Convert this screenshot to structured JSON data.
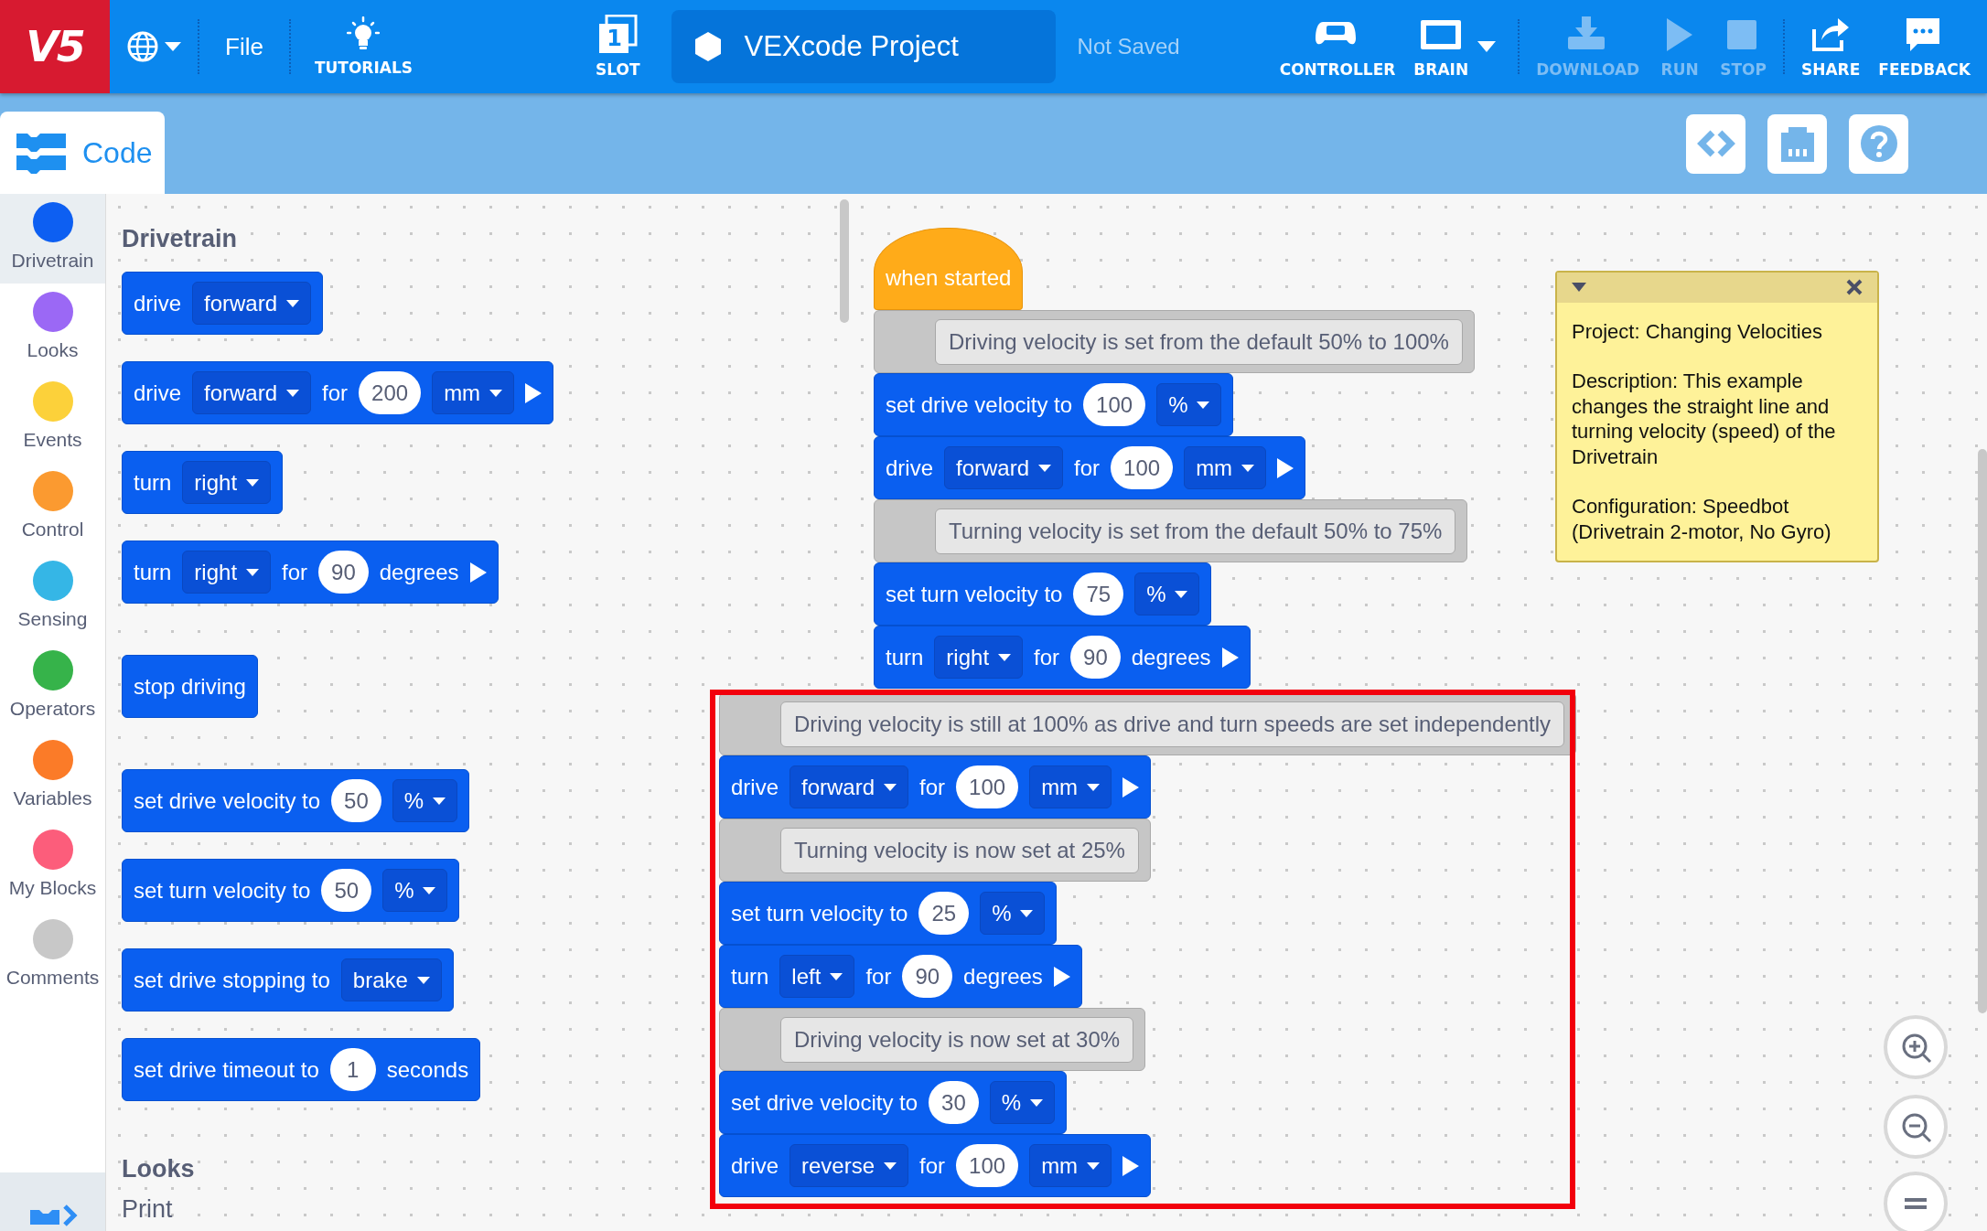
{
  "top_bar": {
    "logo": "V5",
    "file": "File",
    "tutorials": "TUTORIALS",
    "slot": {
      "number": "1",
      "label": "SLOT"
    },
    "project_name": "VEXcode Project",
    "save_status": "Not Saved",
    "tools": [
      {
        "kind": "controller",
        "label": "CONTROLLER",
        "disabled": false
      },
      {
        "kind": "brain",
        "label": "BRAIN",
        "disabled": false
      },
      {
        "kind": "download",
        "label": "DOWNLOAD",
        "disabled": true
      },
      {
        "kind": "run",
        "label": "RUN",
        "disabled": true
      },
      {
        "kind": "stop",
        "label": "STOP",
        "disabled": true
      },
      {
        "kind": "share",
        "label": "SHARE",
        "disabled": false
      },
      {
        "kind": "feedback",
        "label": "FEEDBACK",
        "disabled": false
      }
    ]
  },
  "tabs": [
    {
      "label": "Code",
      "selected": true
    }
  ],
  "categories": [
    {
      "label": "Drivetrain",
      "color": "#0d5ff2",
      "selected": true
    },
    {
      "label": "Looks",
      "color": "#9b68f5",
      "selected": false
    },
    {
      "label": "Events",
      "color": "#fcd13a",
      "selected": false
    },
    {
      "label": "Control",
      "color": "#fb9a30",
      "selected": false
    },
    {
      "label": "Sensing",
      "color": "#35b6e6",
      "selected": false
    },
    {
      "label": "Operators",
      "color": "#36b34a",
      "selected": false
    },
    {
      "label": "Variables",
      "color": "#fb7b28",
      "selected": false
    },
    {
      "label": "My Blocks",
      "color": "#fc5d7b",
      "selected": false
    },
    {
      "label": "Comments",
      "color": "#c8c8c8",
      "selected": false
    }
  ],
  "palette": [
    {
      "title": "Drivetrain",
      "blocks": [
        {
          "kind": "stack",
          "parts": [
            {
              "kind": "text",
              "text": "drive"
            },
            {
              "kind": "dropdown",
              "text": "forward"
            }
          ]
        },
        {
          "kind": "stack",
          "parts": [
            {
              "kind": "text",
              "text": "drive"
            },
            {
              "kind": "dropdown",
              "text": "forward"
            },
            {
              "kind": "text",
              "text": "for"
            },
            {
              "kind": "number",
              "text": "200"
            },
            {
              "kind": "dropdown",
              "text": "mm"
            },
            {
              "kind": "play"
            }
          ]
        },
        {
          "kind": "stack",
          "parts": [
            {
              "kind": "text",
              "text": "turn"
            },
            {
              "kind": "dropdown",
              "text": "right"
            }
          ]
        },
        {
          "kind": "stack",
          "parts": [
            {
              "kind": "text",
              "text": "turn"
            },
            {
              "kind": "dropdown",
              "text": "right"
            },
            {
              "kind": "text",
              "text": "for"
            },
            {
              "kind": "number",
              "text": "90"
            },
            {
              "kind": "text",
              "text": "degrees"
            },
            {
              "kind": "play"
            }
          ]
        },
        {
          "kind": "stack",
          "parts": [
            {
              "kind": "text",
              "text": "stop driving"
            }
          ]
        },
        {
          "kind": "stack",
          "parts": [
            {
              "kind": "text",
              "text": "set drive velocity to"
            },
            {
              "kind": "number",
              "text": "50"
            },
            {
              "kind": "dropdown",
              "text": "%"
            }
          ]
        },
        {
          "kind": "stack",
          "parts": [
            {
              "kind": "text",
              "text": "set turn velocity to"
            },
            {
              "kind": "number",
              "text": "50"
            },
            {
              "kind": "dropdown",
              "text": "%"
            }
          ]
        },
        {
          "kind": "stack",
          "parts": [
            {
              "kind": "text",
              "text": "set drive stopping to"
            },
            {
              "kind": "dropdown",
              "text": "brake"
            }
          ]
        },
        {
          "kind": "stack",
          "parts": [
            {
              "kind": "text",
              "text": "set drive timeout to"
            },
            {
              "kind": "number",
              "text": "1"
            },
            {
              "kind": "text",
              "text": "seconds"
            }
          ]
        }
      ]
    },
    {
      "title": "Looks",
      "labels": [
        "Print"
      ]
    }
  ],
  "workspace": {
    "scripts": [
      {
        "highlighted": false,
        "blocks": [
          {
            "kind": "hat",
            "parts": [
              {
                "kind": "text",
                "text": "when started"
              }
            ]
          },
          {
            "kind": "comment",
            "parts": [
              {
                "kind": "text",
                "text": "Driving velocity is set from the default 50% to 100%"
              }
            ]
          },
          {
            "kind": "stack",
            "parts": [
              {
                "kind": "text",
                "text": "set drive velocity to"
              },
              {
                "kind": "number",
                "text": "100"
              },
              {
                "kind": "dropdown",
                "text": "%"
              }
            ]
          },
          {
            "kind": "stack",
            "parts": [
              {
                "kind": "text",
                "text": "drive"
              },
              {
                "kind": "dropdown",
                "text": "forward"
              },
              {
                "kind": "text",
                "text": "for"
              },
              {
                "kind": "number",
                "text": "100"
              },
              {
                "kind": "dropdown",
                "text": "mm"
              },
              {
                "kind": "play"
              }
            ]
          },
          {
            "kind": "comment",
            "parts": [
              {
                "kind": "text",
                "text": "Turning velocity is set from the default 50% to 75%"
              }
            ]
          },
          {
            "kind": "stack",
            "parts": [
              {
                "kind": "text",
                "text": "set turn velocity to"
              },
              {
                "kind": "number",
                "text": "75"
              },
              {
                "kind": "dropdown",
                "text": "%"
              }
            ]
          },
          {
            "kind": "stack",
            "parts": [
              {
                "kind": "text",
                "text": "turn"
              },
              {
                "kind": "dropdown",
                "text": "right"
              },
              {
                "kind": "text",
                "text": "for"
              },
              {
                "kind": "number",
                "text": "90"
              },
              {
                "kind": "text",
                "text": "degrees"
              },
              {
                "kind": "play"
              }
            ]
          }
        ]
      },
      {
        "highlighted": true,
        "blocks": [
          {
            "kind": "comment",
            "parts": [
              {
                "kind": "text",
                "text": "Driving velocity is still at 100% as drive and turn speeds are set independently"
              }
            ]
          },
          {
            "kind": "stack",
            "parts": [
              {
                "kind": "text",
                "text": "drive"
              },
              {
                "kind": "dropdown",
                "text": "forward"
              },
              {
                "kind": "text",
                "text": "for"
              },
              {
                "kind": "number",
                "text": "100"
              },
              {
                "kind": "dropdown",
                "text": "mm"
              },
              {
                "kind": "play"
              }
            ]
          },
          {
            "kind": "comment",
            "parts": [
              {
                "kind": "text",
                "text": "Turning velocity is now set at 25%"
              }
            ]
          },
          {
            "kind": "stack",
            "parts": [
              {
                "kind": "text",
                "text": "set turn velocity to"
              },
              {
                "kind": "number",
                "text": "25"
              },
              {
                "kind": "dropdown",
                "text": "%"
              }
            ]
          },
          {
            "kind": "stack",
            "parts": [
              {
                "kind": "text",
                "text": "turn"
              },
              {
                "kind": "dropdown",
                "text": "left"
              },
              {
                "kind": "text",
                "text": "for"
              },
              {
                "kind": "number",
                "text": "90"
              },
              {
                "kind": "text",
                "text": "degrees"
              },
              {
                "kind": "play"
              }
            ]
          },
          {
            "kind": "comment",
            "parts": [
              {
                "kind": "text",
                "text": "Driving velocity is now set at 30%"
              }
            ]
          },
          {
            "kind": "stack",
            "parts": [
              {
                "kind": "text",
                "text": "set drive velocity to"
              },
              {
                "kind": "number",
                "text": "30"
              },
              {
                "kind": "dropdown",
                "text": "%"
              }
            ]
          },
          {
            "kind": "stack",
            "parts": [
              {
                "kind": "text",
                "text": "drive"
              },
              {
                "kind": "dropdown",
                "text": "reverse"
              },
              {
                "kind": "text",
                "text": "for"
              },
              {
                "kind": "number",
                "text": "100"
              },
              {
                "kind": "dropdown",
                "text": "mm"
              },
              {
                "kind": "play"
              }
            ]
          }
        ]
      }
    ],
    "note": {
      "paragraphs": [
        "Project: Changing Velocities",
        "Description: This example changes the straight line and turning velocity (speed) of the Drivetrain",
        "Configuration: Speedbot (Drivetrain 2-motor, No Gyro)"
      ]
    }
  }
}
